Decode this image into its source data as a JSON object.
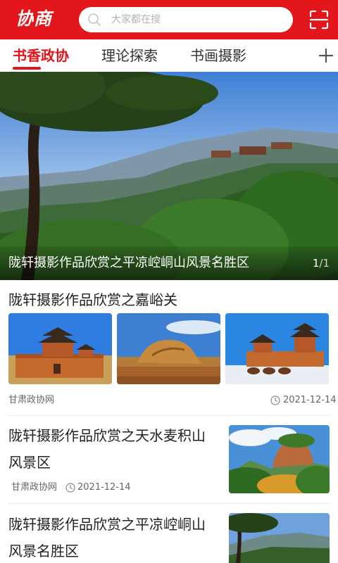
{
  "header": {
    "logo_text": "协商",
    "search_placeholder": "大家都在搜",
    "search_icon": "search-icon",
    "scan_icon": "scan-icon",
    "background": "#e3161b"
  },
  "tabs": [
    {
      "label": "书香政协",
      "active": true
    },
    {
      "label": "理论探索",
      "active": false
    },
    {
      "label": "书画摄影",
      "active": false
    }
  ],
  "tabs_add_icon": "plus-icon",
  "hero": {
    "title": "陇轩摄影作品欣赏之平凉崆峒山风景名胜区",
    "page_current": "1",
    "page_sep": "/",
    "page_total": "1"
  },
  "articles": [
    {
      "title": "陇轩摄影作品欣赏之嘉峪关",
      "source": "甘肃政协网",
      "date": "2021-12-14",
      "images": [
        "jiayuguan-fort",
        "desert-rock",
        "fort-with-camels"
      ]
    },
    {
      "title": "陇轩摄影作品欣赏之天水麦积山风景区",
      "source": "甘肃政协网",
      "date": "2021-12-14",
      "image": "maijishan-grottoes"
    },
    {
      "title": "陇轩摄影作品欣赏之平凉崆峒山风景名胜区",
      "image": "kongtong-mountain"
    }
  ]
}
